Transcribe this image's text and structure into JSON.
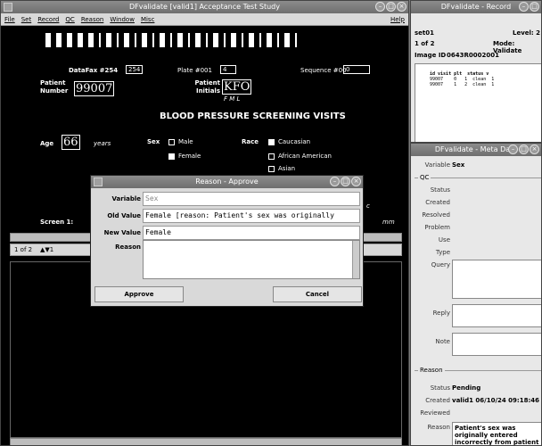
{
  "main": {
    "title": "DFvalidate [valid1] Acceptance Test Study",
    "menu": [
      "File",
      "Set",
      "Record",
      "QC",
      "Reason",
      "Window",
      "Misc"
    ],
    "help": "Help",
    "crf": {
      "datafax_label": "DataFax #254",
      "datafax_value": "254",
      "plate_label": "Plate #001",
      "plate_value": "4",
      "sequence_label": "Sequence #00",
      "sequence_value": "0",
      "patient_number_label": "Patient Number",
      "patient_number_value": "99007",
      "patient_initials_label": "Patient Initials",
      "patient_initials_value": "KFO",
      "initials_fml": "F   M   L",
      "heading": "BLOOD PRESSURE SCREENING VISITS",
      "age_label": "Age",
      "age_value": "66",
      "age_unit": "years",
      "sex_label": "Sex",
      "sex_male": "Male",
      "sex_female": "Female",
      "race_label": "Race",
      "race_caucasian": "Caucasian",
      "race_african": "African American",
      "race_asian": "Asian",
      "screen_label": "Screen 1:",
      "right_c": "c",
      "right_mm": "mm"
    },
    "nav": {
      "position": "1 of 2",
      "arrows": "▲▼1"
    }
  },
  "record": {
    "title": "DFvalidate - Record",
    "set": "set01",
    "level": "Level: 2",
    "count": "1 of 2",
    "mode": "Mode: Validate",
    "image_id_label": "Image ID",
    "image_id_value": "0643R0002001",
    "table_header": "id visit plt  status v",
    "rows": [
      "99007    0   1  clean  1",
      "99007    1   2  clean  1"
    ]
  },
  "meta": {
    "title": "DFvalidate - Meta Data",
    "variable_label": "Variable",
    "variable_value": "Sex",
    "qc_section": "QC",
    "qc_fields": [
      "Status",
      "Created",
      "Resolved",
      "Problem",
      "Use",
      "Type",
      "Query"
    ],
    "reply_label": "Reply",
    "note_label": "Note",
    "reason_section": "Reason",
    "reason_status_label": "Status",
    "reason_status_value": "Pending",
    "reason_created_label": "Created",
    "reason_created_value": "valid1 06/10/24 09:18:46",
    "reason_reviewed_label": "Reviewed",
    "reason_reason_label": "Reason",
    "reason_text": "Patient's sex was originally entered incorrectly from patient chart."
  },
  "dialog": {
    "title": "Reason - Approve",
    "variable_label": "Variable",
    "variable_value": "Sex",
    "old_label": "Old Value",
    "old_value": "Female [reason: Patient's sex was originally",
    "new_label": "New Value",
    "new_value": "Female",
    "reason_label": "Reason",
    "approve": "Approve",
    "cancel": "Cancel"
  }
}
